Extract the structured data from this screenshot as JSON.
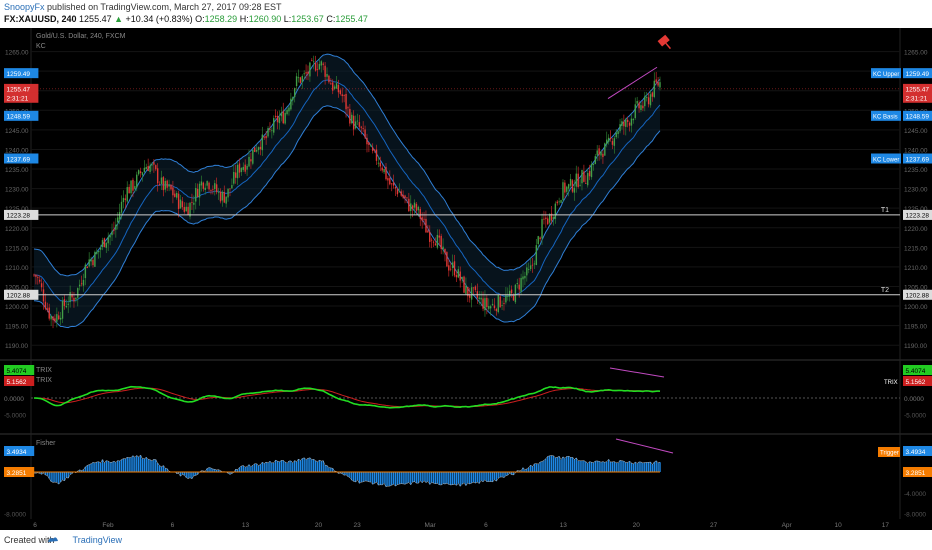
{
  "header": {
    "author": "SnoopyFx",
    "published": "published on TradingView.com, March 27, 2017 09:28 EST",
    "symbol_line": "FX:XAUUSD, 240",
    "last": "1255.47",
    "change": "+10.34 (+0.83%)",
    "open_label": "O:",
    "open": "1258.29",
    "high_label": "H:",
    "high": "1260.90",
    "low_label": "L:",
    "low": "1253.67",
    "close_label": "C:",
    "close": "1255.47"
  },
  "footer": {
    "created_with": "Created with",
    "brand": "TradingView"
  },
  "chart_data": [
    {
      "type": "candlestick",
      "title": "Gold/U.S. Dollar, 240, FXCM",
      "indicator_label": "KC",
      "ylim": [
        1187.5,
        1270
      ],
      "yticks": [
        1265,
        1260,
        1255,
        1250,
        1245,
        1240,
        1235,
        1230,
        1225,
        1220,
        1215,
        1210,
        1205,
        1200,
        1195,
        1190
      ],
      "ytick_labels": [
        "1265.00",
        "1260.00",
        "1255.00",
        "1250.00",
        "1245.00",
        "1240.00",
        "1235.00",
        "1230.00",
        "1225.00",
        "1220.00",
        "1215.00",
        "1210.00",
        "1205.00",
        "1200.00",
        "1195.00",
        "1190.00"
      ],
      "x_ticks": [
        "6",
        "Feb",
        "6",
        "13",
        "20",
        "23",
        "Mar",
        "6",
        "13",
        "20",
        "27",
        "Apr",
        "10",
        "17"
      ],
      "x_tick_pos": [
        0.0,
        0.085,
        0.16,
        0.245,
        0.33,
        0.375,
        0.46,
        0.525,
        0.615,
        0.7,
        0.79,
        0.875,
        0.935,
        0.99
      ],
      "x_range_days": 100,
      "close_anchors": [
        [
          0,
          1208
        ],
        [
          2,
          1197
        ],
        [
          4,
          1202
        ],
        [
          6,
          1212
        ],
        [
          8,
          1218
        ],
        [
          10,
          1230
        ],
        [
          12,
          1236
        ],
        [
          14,
          1230
        ],
        [
          16,
          1225
        ],
        [
          18,
          1232
        ],
        [
          20,
          1228
        ],
        [
          22,
          1236
        ],
        [
          24,
          1242
        ],
        [
          26,
          1248
        ],
        [
          28,
          1258
        ],
        [
          30,
          1262
        ],
        [
          32,
          1255
        ],
        [
          34,
          1246
        ],
        [
          36,
          1238
        ],
        [
          38,
          1230
        ],
        [
          40,
          1225
        ],
        [
          42,
          1218
        ],
        [
          44,
          1210
        ],
        [
          46,
          1203
        ],
        [
          48,
          1200
        ],
        [
          50,
          1202
        ],
        [
          52,
          1208
        ],
        [
          54,
          1222
        ],
        [
          56,
          1230
        ],
        [
          58,
          1233
        ],
        [
          60,
          1240
        ],
        [
          62,
          1246
        ],
        [
          64,
          1251
        ],
        [
          66,
          1257
        ]
      ],
      "keltner": {
        "upper": 1259.49,
        "basis": 1248.59,
        "lower": 1237.69
      },
      "price_labels": [
        {
          "text": "1259.49",
          "color": "#1e88e5",
          "value": 1259.49
        },
        {
          "text": "1255.47",
          "color": "#d32f2f",
          "value": 1255.47
        },
        {
          "text": "2:31:21",
          "color": "#d32f2f",
          "value": 1253.2
        },
        {
          "text": "1248.59",
          "color": "#1e88e5",
          "value": 1248.59
        },
        {
          "text": "1237.69",
          "color": "#1e88e5",
          "value": 1237.69
        },
        {
          "text": "1223.28",
          "color": "#dddddd",
          "value": 1223.28
        },
        {
          "text": "1202.88",
          "color": "#dddddd",
          "value": 1202.88
        }
      ],
      "band_labels": [
        {
          "text": "KC Upper",
          "value": 1259.49
        },
        {
          "text": "KC Basis",
          "value": 1248.59
        },
        {
          "text": "KC Lower",
          "value": 1237.69
        }
      ],
      "levels": [
        {
          "name": "T1",
          "value": 1223.28
        },
        {
          "name": "T2",
          "value": 1202.88
        }
      ],
      "trendline_color": "#c24ac2"
    },
    {
      "type": "line",
      "title": "TRIX",
      "series": [
        {
          "name": "TRIX",
          "color": "#22dd22",
          "last": "5.4074"
        },
        {
          "name": "TRIX",
          "color": "#cc1f1f",
          "last": "5.1562"
        }
      ],
      "zero_label": "0.0000",
      "ytick_labels": [
        "5.0000",
        "0.0000",
        "-5.0000"
      ],
      "right_tag": "TRIX"
    },
    {
      "type": "histogram",
      "title": "Fisher",
      "series": [
        {
          "name": "Fisher",
          "color": "#1e88e5",
          "last": "3.4934"
        },
        {
          "name": "Trigger",
          "color": "#f57c00",
          "last": "3.2851"
        }
      ],
      "ytick_labels": [
        "4.0000",
        "0.0000",
        "-4.0000",
        "-8.0000"
      ],
      "right_tag": "Trigger"
    }
  ]
}
